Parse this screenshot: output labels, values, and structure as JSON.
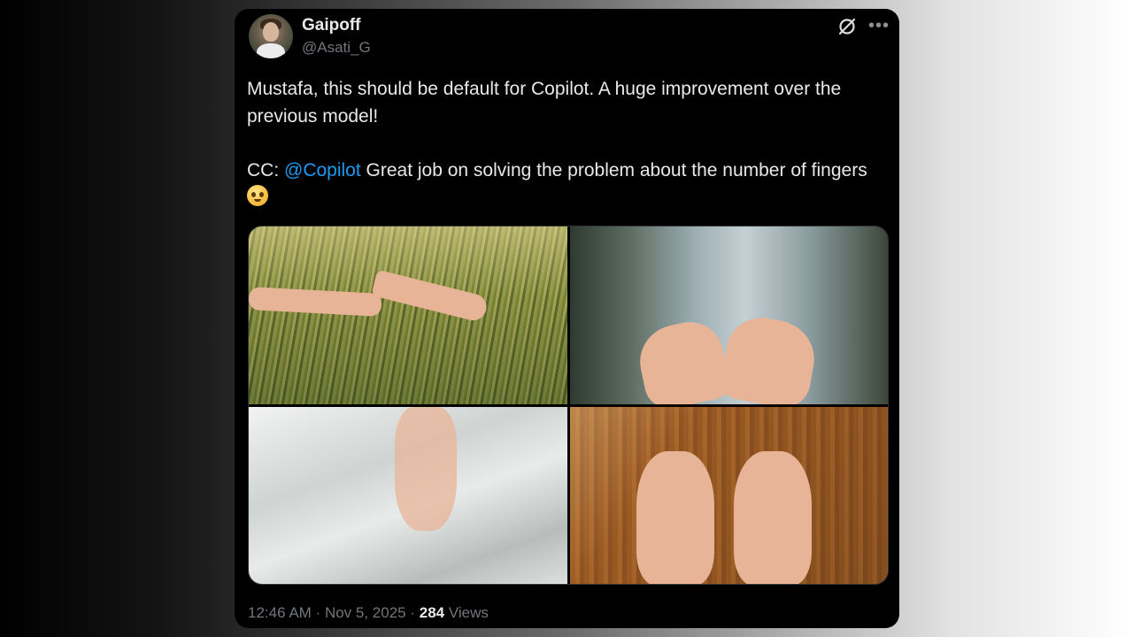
{
  "tweet": {
    "author_name": "Gaipoff",
    "author_handle": "@Asati_G",
    "text_line1": "Mustafa, this should be default for Copilot. A huge improvement over the previous model!",
    "text_cc_prefix": "CC: ",
    "mention": "@Copilot",
    "text_cc_rest": " Great job on solving the problem about the number of fingers ",
    "emoji": "🥹",
    "time": "12:46 AM",
    "separator": " · ",
    "date": "Nov 5, 2025",
    "views_count": "284",
    "views_label": " Views"
  },
  "icons": {
    "grok": "grok-icon",
    "more": "more-icon"
  },
  "photos": [
    {
      "name": "hand-in-grass-photo"
    },
    {
      "name": "hands-catching-rain-photo"
    },
    {
      "name": "hand-under-tulle-photo"
    },
    {
      "name": "hands-on-wood-photo"
    }
  ],
  "colors": {
    "card_bg": "#000000",
    "text": "#e7e9ea",
    "muted": "#71767b",
    "link": "#1d9bf0"
  }
}
